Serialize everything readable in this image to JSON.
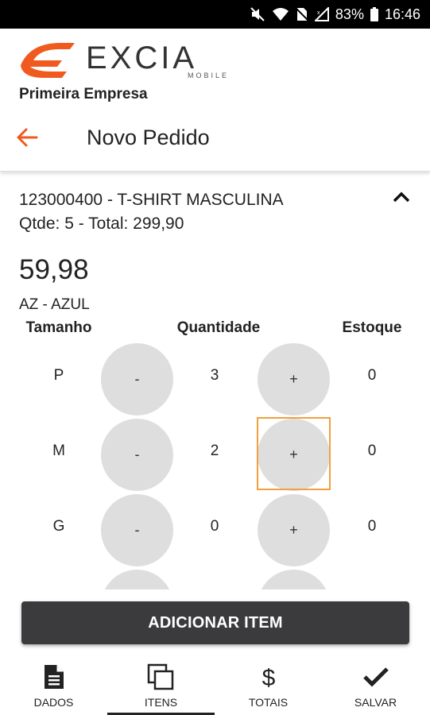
{
  "status_bar": {
    "battery": "83%",
    "time": "16:46"
  },
  "brand": {
    "name": "EXCIA",
    "tagline": "MOBILE",
    "accent": "#f05a1e",
    "dark": "#333333"
  },
  "company": "Primeira Empresa",
  "appbar": {
    "title": "Novo Pedido",
    "back_icon": "arrow-left-icon"
  },
  "product": {
    "title": "123000400 - T-SHIRT MASCULINA",
    "summary": "Qtde: 5 - Total: 299,90",
    "price": "59,98",
    "color": "AZ - AZUL"
  },
  "table": {
    "headers": {
      "size": "Tamanho",
      "quantity": "Quantidade",
      "stock": "Estoque"
    },
    "minus_label": "-",
    "plus_label": "+",
    "rows": [
      {
        "size": "P",
        "quantity": "3",
        "stock": "0"
      },
      {
        "size": "M",
        "quantity": "2",
        "stock": "0"
      },
      {
        "size": "G",
        "quantity": "0",
        "stock": "0"
      }
    ]
  },
  "add_button": "ADICIONAR ITEM",
  "bottom_nav": [
    {
      "label": "DADOS",
      "icon": "document-icon"
    },
    {
      "label": "ITENS",
      "icon": "copy-icon",
      "active": true
    },
    {
      "label": "TOTAIS",
      "icon": "dollar-icon"
    },
    {
      "label": "SALVAR",
      "icon": "check-icon"
    }
  ]
}
